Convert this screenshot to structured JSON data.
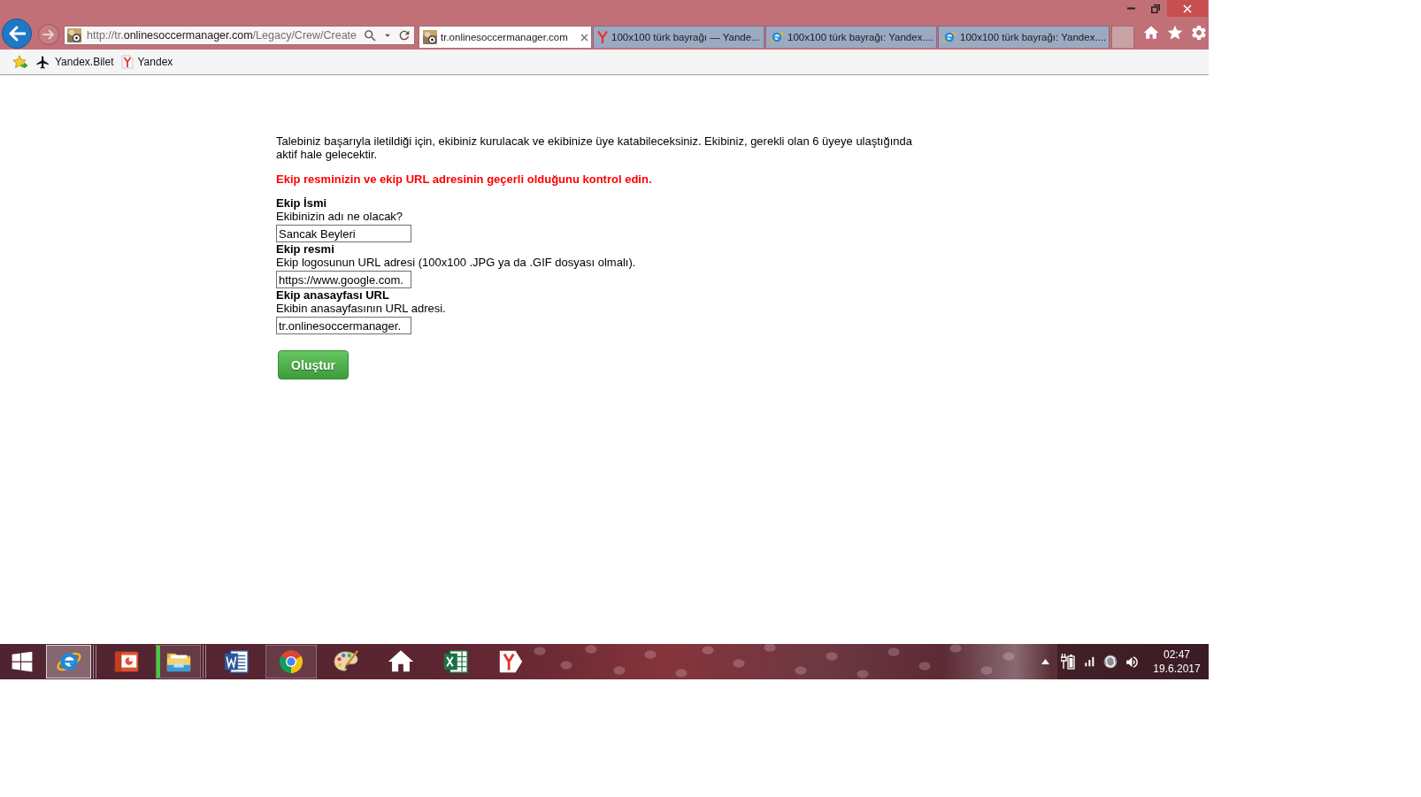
{
  "browser": {
    "address_bar": {
      "url_parts": [
        {
          "text": "http://tr.",
          "emphasis": false
        },
        {
          "text": "onlinesoccermanager.com",
          "emphasis": true
        },
        {
          "text": "/Legacy/Crew/Create",
          "emphasis": false
        }
      ]
    },
    "tabs": [
      {
        "title": "tr.onlinesoccermanager.com",
        "kind": "site",
        "selected": true
      },
      {
        "title": "100x100 türk bayrağı — Yande...",
        "kind": "yandex",
        "selected": false
      },
      {
        "title": "100x100 türk bayrağı: Yandex....",
        "kind": "ie",
        "selected": false
      },
      {
        "title": "100x100 türk bayrağı: Yandex....",
        "kind": "ie",
        "selected": false
      }
    ],
    "favorites": [
      {
        "label": "Yandex.Bilet",
        "kind": "plane"
      },
      {
        "label": "Yandex",
        "kind": "yandex"
      }
    ]
  },
  "page": {
    "intro": "Talebiniz başarıyla iletildiği için, ekibiniz kurulacak ve ekibinize üye katabileceksiniz. Ekibiniz, gerekli olan 6 üyeye ulaştığında aktif hale gelecektir.",
    "warning": "Ekip resminizin ve ekip URL adresinin geçerli olduğunu kontrol edin.",
    "fields": [
      {
        "label": "Ekip İsmi",
        "hint": "Ekibinizin adı ne olacak?",
        "value": "Sancak Beyleri"
      },
      {
        "label": "Ekip resmi",
        "hint": "Ekip logosunun URL adresi (100x100 .JPG ya da .GIF dosyası olmalı).",
        "value": "https://www.google.com."
      },
      {
        "label": "Ekip anasayfası URL",
        "hint": "Ekibin anasayfasının URL adresi.",
        "value": "tr.onlinesoccermanager."
      }
    ],
    "submit_button": "Oluştur"
  },
  "taskbar": {
    "apps": [
      {
        "kind": "ie",
        "running": true,
        "active": true,
        "stacked": true
      },
      {
        "kind": "presentation",
        "running": false,
        "active": false,
        "stacked": false
      },
      {
        "kind": "explorer",
        "running": true,
        "active": false,
        "stacked": true,
        "level": 0.08
      },
      {
        "kind": "word",
        "running": false,
        "active": false,
        "stacked": false
      },
      {
        "kind": "chrome",
        "running": true,
        "active": false,
        "stacked": false
      },
      {
        "kind": "paint",
        "running": false,
        "active": false,
        "stacked": false
      },
      {
        "kind": "home",
        "running": false,
        "active": false,
        "stacked": false
      },
      {
        "kind": "excel",
        "running": false,
        "active": false,
        "stacked": false
      },
      {
        "kind": "yandex",
        "running": false,
        "active": false,
        "stacked": false
      }
    ],
    "clock": {
      "time": "02:47",
      "date": "19.6.2017"
    }
  }
}
